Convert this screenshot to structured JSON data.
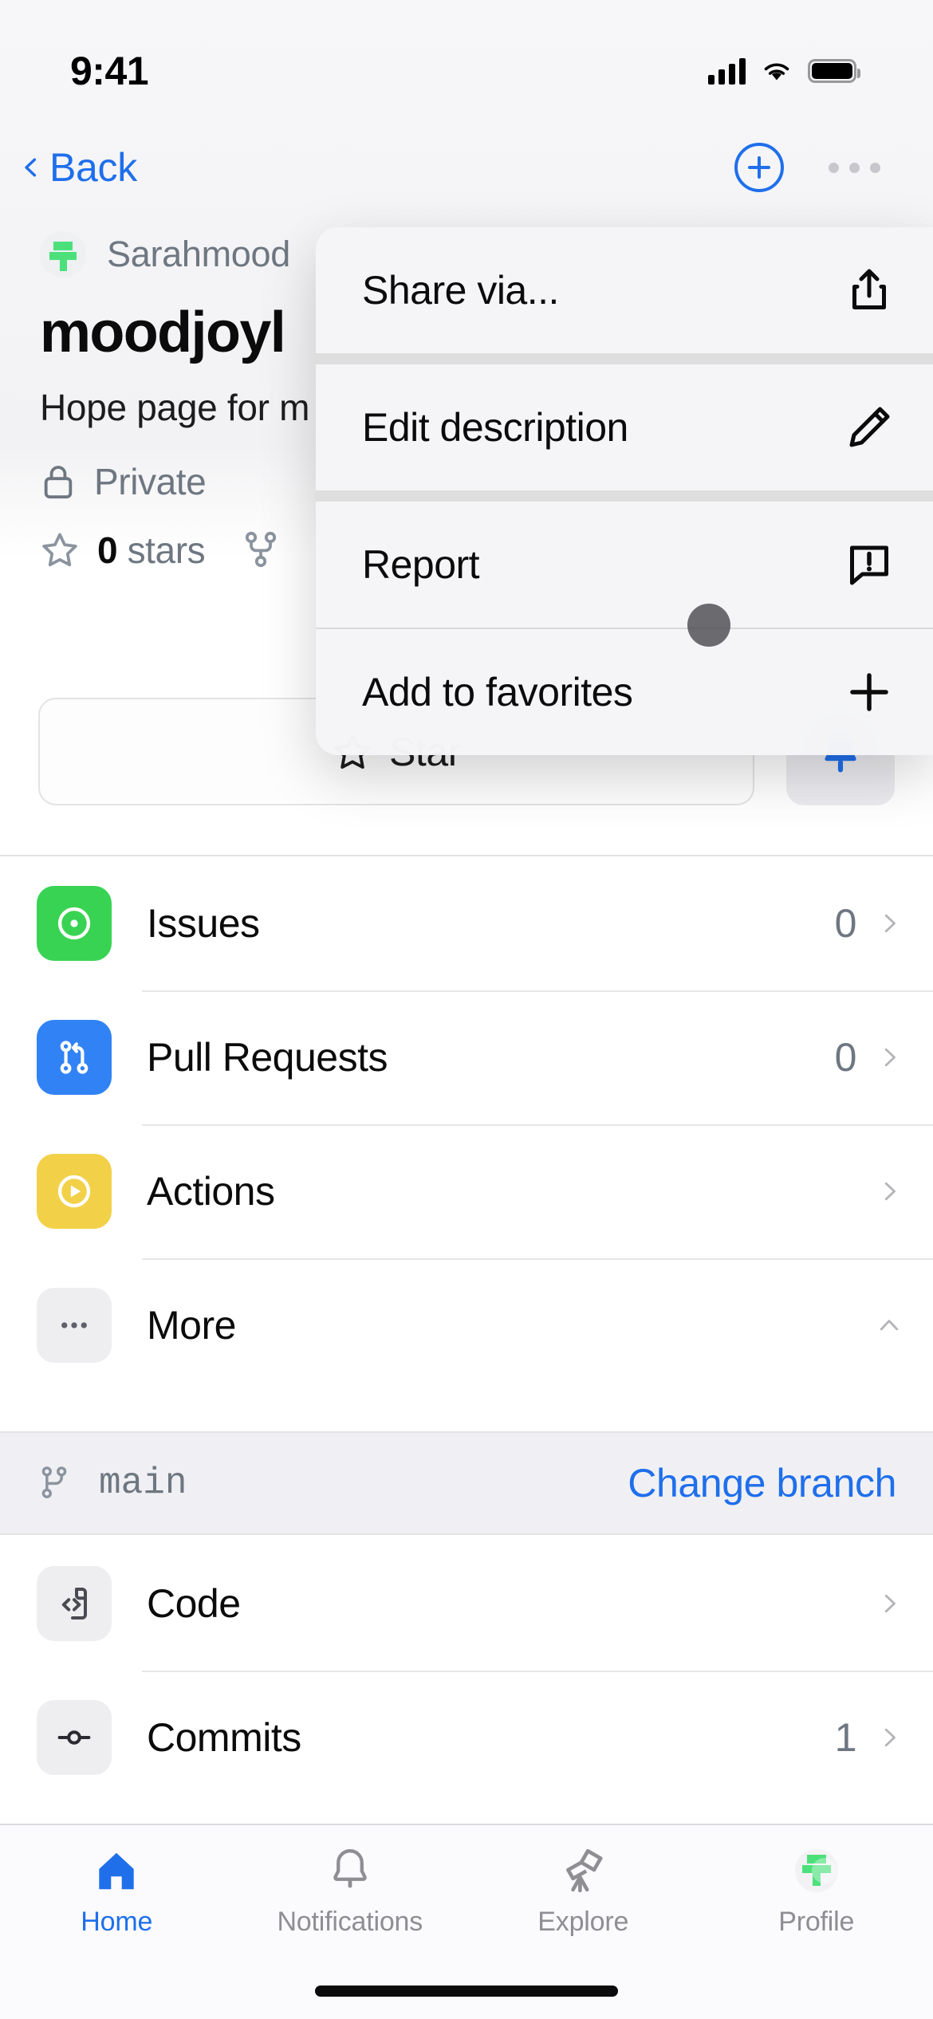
{
  "status_bar": {
    "time": "9:41",
    "cellular_icon": "cellular-bars-icon",
    "wifi_icon": "wifi-icon",
    "battery_icon": "battery-icon"
  },
  "nav_bar": {
    "back_label": "Back",
    "back_icon": "chevron-left-icon",
    "add_icon": "plus-circle-icon",
    "more_icon": "ellipsis-icon",
    "accent_color": "#1f6feb"
  },
  "repo": {
    "owner": "Sarahmood",
    "owner_avatar_icon": "github-avatar-icon",
    "name": "moodjoyl",
    "description": "Hope page for m",
    "visibility": "Private",
    "visibility_icon": "lock-icon",
    "stars_count": "0",
    "stars_label": "stars",
    "star_icon": "star-icon",
    "fork_icon": "fork-icon"
  },
  "actions": {
    "star_label": "Star",
    "star_icon": "star-icon",
    "notify_icon": "bell-filled-icon"
  },
  "list": {
    "items": [
      {
        "label": "Issues",
        "count": "0",
        "icon": "issue-opened-icon",
        "icon_style": "ic-green",
        "accessory": "chevron-right-icon"
      },
      {
        "label": "Pull Requests",
        "count": "0",
        "icon": "git-pull-request-icon",
        "icon_style": "ic-blue",
        "accessory": "chevron-right-icon"
      },
      {
        "label": "Actions",
        "count": "",
        "icon": "play-circle-icon",
        "icon_style": "ic-yellow",
        "accessory": "chevron-right-icon"
      },
      {
        "label": "More",
        "count": "",
        "icon": "ellipsis-icon",
        "icon_style": "ic-gray",
        "accessory": "chevron-up-icon"
      }
    ]
  },
  "branch": {
    "icon": "branch-icon",
    "name": "main",
    "change_label": "Change branch"
  },
  "sub_list": {
    "items": [
      {
        "label": "Code",
        "count": "",
        "icon": "file-code-icon",
        "icon_style": "ic-gray",
        "accessory": "chevron-right-icon"
      },
      {
        "label": "Commits",
        "count": "1",
        "icon": "git-commit-icon",
        "icon_style": "ic-gray",
        "accessory": "chevron-right-icon"
      }
    ]
  },
  "context_menu": {
    "items": [
      {
        "label": "Share via...",
        "icon": "share-icon"
      },
      {
        "label": "Edit description",
        "icon": "pencil-icon"
      },
      {
        "label": "Report",
        "icon": "report-comment-icon"
      },
      {
        "label": "Add to favorites",
        "icon": "plus-icon"
      }
    ]
  },
  "tab_bar": {
    "tabs": [
      {
        "label": "Home",
        "icon": "home-icon",
        "active": true
      },
      {
        "label": "Notifications",
        "icon": "bell-icon",
        "active": false
      },
      {
        "label": "Explore",
        "icon": "telescope-icon",
        "active": false
      },
      {
        "label": "Profile",
        "icon": "profile-avatar-icon",
        "active": false
      }
    ]
  }
}
